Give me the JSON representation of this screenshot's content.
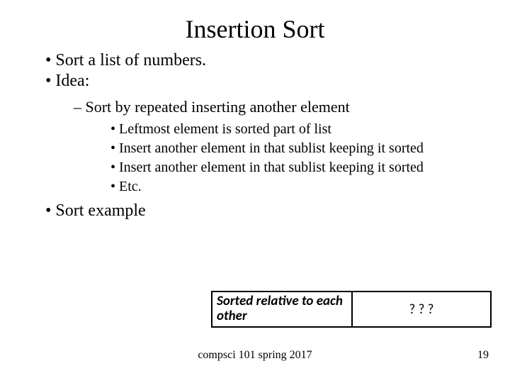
{
  "title": "Insertion Sort",
  "bullets": {
    "b1": "Sort a list of numbers.",
    "b2": "Idea:",
    "b2_sub": "Sort by repeated inserting another element",
    "b2_sub_items": {
      "i1": "Leftmost element is sorted part of list",
      "i2": "Insert another element in that sublist keeping it sorted",
      "i3": "Insert another element in that sublist keeping it sorted",
      "i4": "Etc."
    },
    "b3": "Sort example"
  },
  "boxes": {
    "left": "Sorted relative to each other",
    "right": "? ? ?"
  },
  "footer": {
    "course": "compsci 101 spring 2017",
    "page": "19"
  }
}
